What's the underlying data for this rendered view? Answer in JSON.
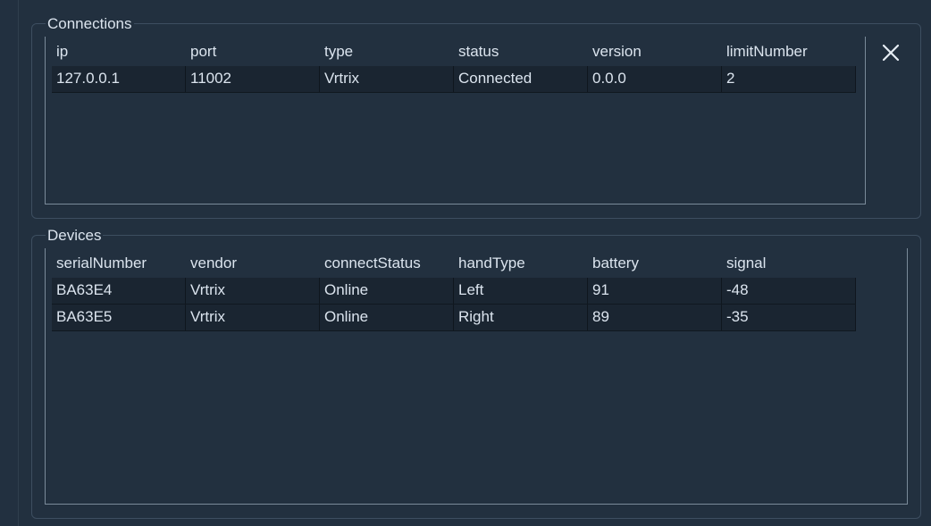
{
  "connections": {
    "title": "Connections",
    "columns": [
      "ip",
      "port",
      "type",
      "status",
      "version",
      "limitNumber"
    ],
    "rows": [
      [
        "127.0.0.1",
        "11002",
        "Vrtrix",
        "Connected",
        "0.0.0",
        "2"
      ]
    ]
  },
  "devices": {
    "title": "Devices",
    "columns": [
      "serialNumber",
      "vendor",
      "connectStatus",
      "handType",
      "battery",
      "signal"
    ],
    "rows": [
      [
        "BA63E4",
        "Vrtrix",
        "Online",
        "Left",
        "91",
        "-48"
      ],
      [
        "BA63E5",
        "Vrtrix",
        "Online",
        "Right",
        "89",
        "-35"
      ]
    ]
  },
  "icons": {
    "close": "close-icon"
  },
  "colors": {
    "background": "#22303f",
    "row_background": "#1a2531",
    "border": "#3d4e60",
    "text": "#dbe4ee"
  }
}
